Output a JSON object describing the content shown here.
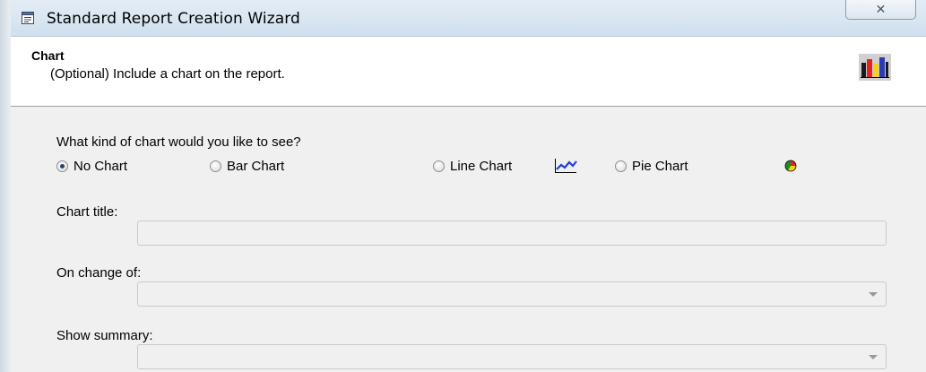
{
  "window": {
    "title": "Standard Report Creation Wizard",
    "close_glyph": "✕"
  },
  "header": {
    "title": "Chart",
    "subtitle": "(Optional) Include a chart on the report.",
    "icon": "bar-chart-icon"
  },
  "chart_type": {
    "question": "What kind of chart would you like to see?",
    "selected": "no_chart",
    "options": [
      {
        "id": "no_chart",
        "label": "No Chart",
        "checked": true
      },
      {
        "id": "bar_chart",
        "label": "Bar Chart",
        "checked": false
      },
      {
        "id": "line_chart",
        "label": "Line Chart",
        "checked": false,
        "icon": "line-chart-icon"
      },
      {
        "id": "pie_chart",
        "label": "Pie Chart",
        "checked": false,
        "icon": "pie-chart-icon"
      }
    ]
  },
  "fields": {
    "chart_title": {
      "label": "Chart title:",
      "value": "",
      "enabled": false
    },
    "on_change_of": {
      "label": "On change of:",
      "value": "",
      "enabled": false
    },
    "show_summary": {
      "label": "Show summary:",
      "value": "",
      "enabled": false
    }
  },
  "colors": {
    "titlebar": "#d9e6f2",
    "dialog_bg": "#f0f0f0",
    "header_bg": "#ffffff",
    "radio_dot": "#27466e"
  }
}
